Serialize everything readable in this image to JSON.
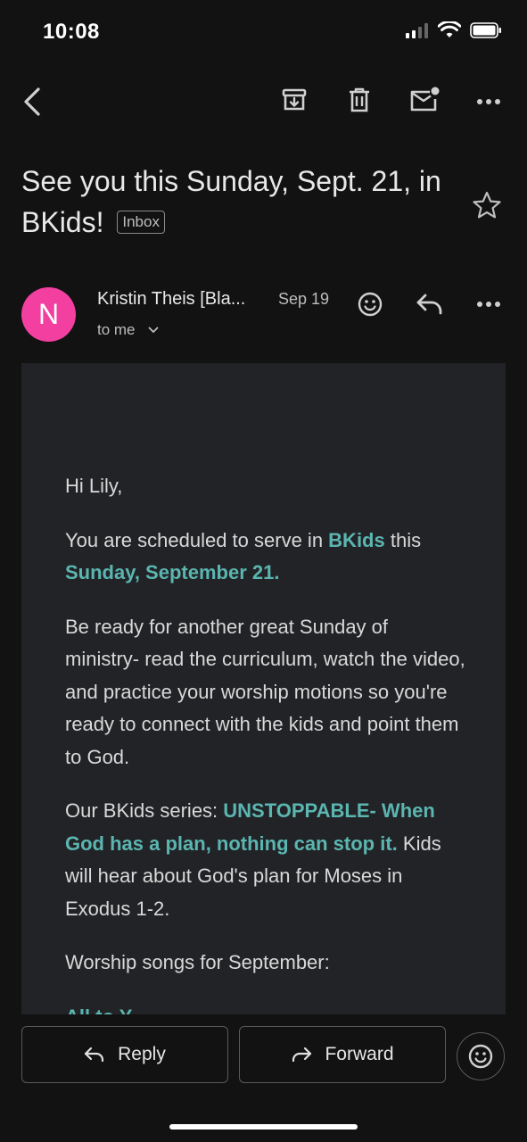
{
  "status_bar": {
    "time": "10:08"
  },
  "email": {
    "subject": "See you this Sunday, Sept. 21, in BKids!",
    "label": "Inbox",
    "sender_initial": "N",
    "sender_name": "Kristin Theis [Bla...",
    "date": "Sep 19",
    "recipient": "to me"
  },
  "body": {
    "greeting": "Hi Lily,",
    "p1_a": "You are scheduled to serve in ",
    "p1_b": "BKids",
    "p1_c": " this ",
    "p1_d": "Sunday, September 21.",
    "p2": "Be ready for another great Sunday of ministry- read the curriculum, watch the video, and practice your worship motions so you're ready to connect with the kids and point them to God.",
    "p3_a": "Our BKids series: ",
    "p3_b": "UNSTOPPABLE- When God has a plan, nothing can stop it.",
    "p3_c": "  Kids will hear about God's plan for Moses in Exodus 1-2.",
    "p4": "Worship songs for September:",
    "p5_partial": "All to Y..."
  },
  "actions": {
    "reply_label": "Reply",
    "forward_label": "Forward"
  },
  "colors": {
    "accent": "#5bb5b0",
    "avatar": "#f23fa0",
    "background": "#121212",
    "card": "#222326"
  }
}
